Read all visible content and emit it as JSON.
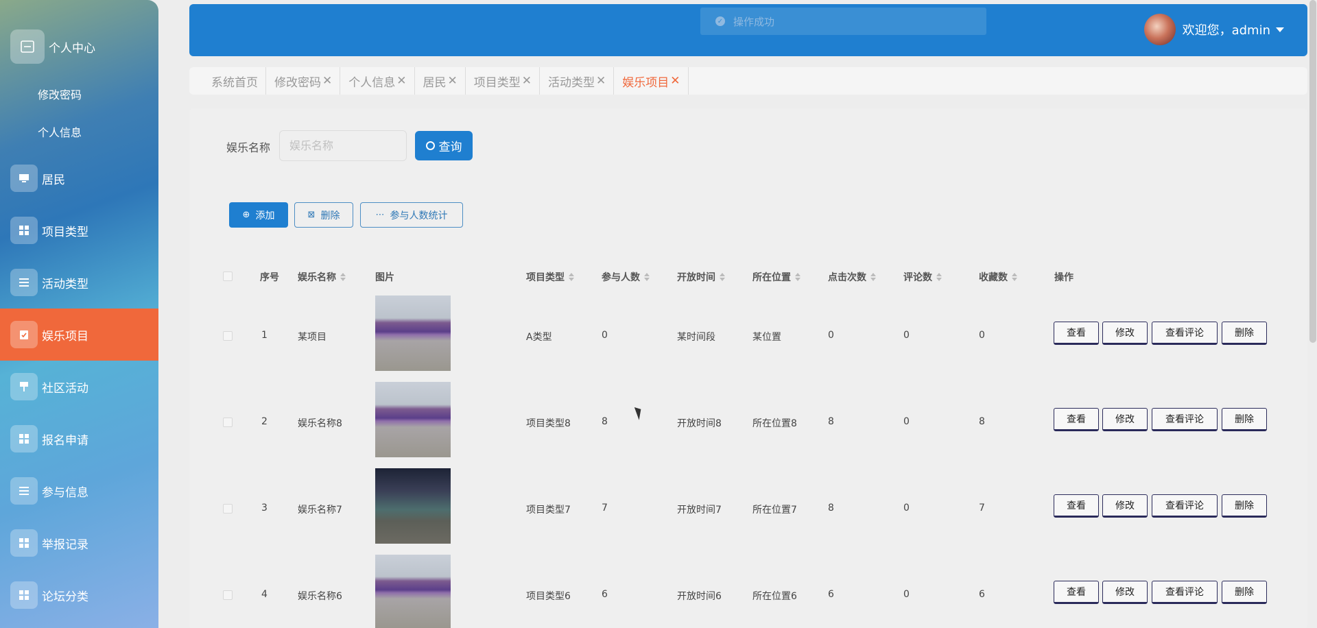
{
  "sidebar": {
    "top_item": "个人中心",
    "sub_items": [
      "修改密码",
      "个人信息"
    ],
    "items": [
      {
        "label": "居民",
        "icon": "monitor-icon"
      },
      {
        "label": "项目类型",
        "icon": "grid-icon"
      },
      {
        "label": "活动类型",
        "icon": "list-icon"
      },
      {
        "label": "娱乐项目",
        "icon": "clipboard-icon"
      },
      {
        "label": "社区活动",
        "icon": "pin-icon"
      },
      {
        "label": "报名申请",
        "icon": "grid-icon"
      },
      {
        "label": "参与信息",
        "icon": "list-icon"
      },
      {
        "label": "举报记录",
        "icon": "grid-icon"
      },
      {
        "label": "论坛分类",
        "icon": "grid-icon"
      }
    ],
    "active": "娱乐项目",
    "active_color": "#f0683b"
  },
  "header": {
    "toast": "操作成功",
    "welcome": "欢迎您，admin"
  },
  "tabs": [
    {
      "label": "系统首页",
      "close": ""
    },
    {
      "label": "修改密码",
      "close": "✕"
    },
    {
      "label": "个人信息",
      "close": "✕"
    },
    {
      "label": "居民",
      "close": "✕"
    },
    {
      "label": "项目类型",
      "close": "✕"
    },
    {
      "label": "活动类型",
      "close": "✕"
    },
    {
      "label": "娱乐项目",
      "close": "✕"
    }
  ],
  "search": {
    "label": "娱乐名称",
    "placeholder": "娱乐名称",
    "button": "查询"
  },
  "actions": {
    "add": "添加",
    "delete": "删除",
    "stats": "参与人数统计"
  },
  "table": {
    "headers": [
      "序号",
      "娱乐名称",
      "图片",
      "项目类型",
      "参与人数",
      "开放时间",
      "所在位置",
      "点击次数",
      "评论数",
      "收藏数",
      "操作"
    ],
    "rows": [
      {
        "no": "1",
        "name": "某项目",
        "type": "A类型",
        "participants": "0",
        "open_time": "某时间段",
        "location": "某位置",
        "clicks": "0",
        "comments": "0",
        "favorites": "0"
      },
      {
        "no": "2",
        "name": "娱乐名称8",
        "type": "项目类型8",
        "participants": "8",
        "open_time": "开放时间8",
        "location": "所在位置8",
        "clicks": "8",
        "comments": "0",
        "favorites": "8"
      },
      {
        "no": "3",
        "name": "娱乐名称7",
        "type": "项目类型7",
        "participants": "7",
        "open_time": "开放时间7",
        "location": "所在位置7",
        "clicks": "8",
        "comments": "0",
        "favorites": "7"
      },
      {
        "no": "4",
        "name": "娱乐名称6",
        "type": "项目类型6",
        "participants": "6",
        "open_time": "开放时间6",
        "location": "所在位置6",
        "clicks": "6",
        "comments": "0",
        "favorites": "6"
      }
    ],
    "row_ops": {
      "view": "查看",
      "edit": "修改",
      "comments": "查看评论",
      "delete": "删除"
    }
  }
}
